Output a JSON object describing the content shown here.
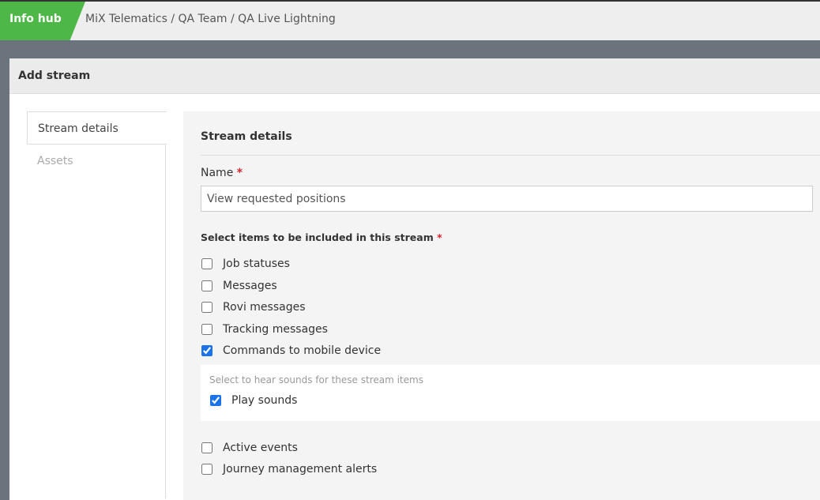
{
  "topbar": {
    "app_name": "Info hub",
    "breadcrumb": "MiX Telematics / QA Team / QA Live Lightning"
  },
  "panel": {
    "title": "Add stream"
  },
  "sidenav": {
    "items": [
      {
        "label": "Stream details",
        "state": "active"
      },
      {
        "label": "Assets",
        "state": "disabled"
      }
    ]
  },
  "form": {
    "section_title": "Stream details",
    "name_label": "Name",
    "required_mark": "*",
    "name_value": "View requested positions",
    "items_label": "Select items to be included in this stream",
    "items": [
      {
        "label": "Job statuses",
        "checked": false
      },
      {
        "label": "Messages",
        "checked": false
      },
      {
        "label": "Rovi messages",
        "checked": false
      },
      {
        "label": "Tracking messages",
        "checked": false
      },
      {
        "label": "Commands to mobile device",
        "checked": true
      },
      {
        "label": "Active events",
        "checked": false
      },
      {
        "label": "Journey management alerts",
        "checked": false
      }
    ],
    "sounds": {
      "hint": "Select to hear sounds for these stream items",
      "label": "Play sounds",
      "checked": true
    }
  },
  "colors": {
    "accent": "#4db848",
    "checkbox": "#1a73e8",
    "required": "#d9262c"
  }
}
